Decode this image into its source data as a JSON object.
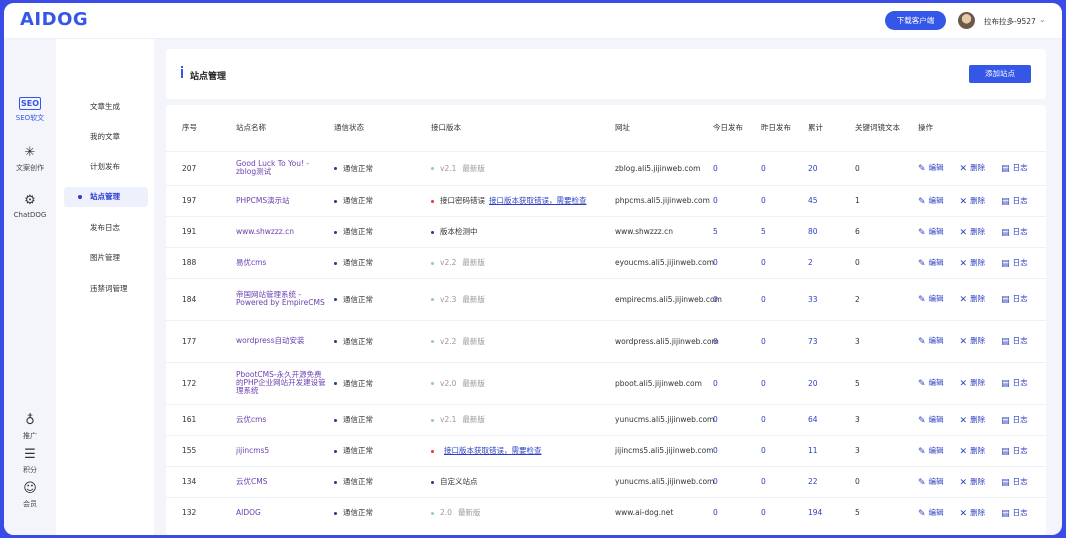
{
  "brand": {
    "logo": "AIDOG"
  },
  "topbar": {
    "download_label": "下载客户端",
    "username": "拉布拉多-9527"
  },
  "rail": [
    {
      "label": "SEO软文",
      "icon": "seo-icon",
      "active": true
    },
    {
      "label": "文案创作",
      "icon": "sparkle-icon",
      "active": false
    },
    {
      "label": "ChatDOG",
      "icon": "openai-icon",
      "active": false
    },
    {
      "label": "推广",
      "icon": "money-bag-icon",
      "active": false
    },
    {
      "label": "积分",
      "icon": "coins-icon",
      "active": false
    },
    {
      "label": "会员",
      "icon": "user-icon",
      "active": false
    }
  ],
  "sidebar": {
    "items": [
      {
        "label": "文章生成",
        "active": false
      },
      {
        "label": "我的文章",
        "active": false
      },
      {
        "label": "计划发布",
        "active": false
      },
      {
        "label": "站点管理",
        "active": true
      },
      {
        "label": "发布日志",
        "active": false
      },
      {
        "label": "图片管理",
        "active": false
      },
      {
        "label": "违禁词管理",
        "active": false
      }
    ]
  },
  "page": {
    "title": "站点管理",
    "add_label": "添加站点"
  },
  "table": {
    "columns": [
      "序号",
      "站点名称",
      "通信状态",
      "接口版本",
      "网址",
      "今日发布",
      "昨日发布",
      "累计",
      "关键词镜文本",
      "操作"
    ],
    "actions": {
      "edit": "编辑",
      "delete": "删除",
      "log": "日志"
    },
    "rows": [
      {
        "id": "207",
        "name": "Good Luck To You! - zblog测试",
        "status": "通信正常",
        "ver_type": "ok",
        "ver": "v2.1",
        "ver_note": "最新版",
        "url": "zblog.ali5.jijinweb.com",
        "today": "0",
        "yesterday": "0",
        "total": "20",
        "kw": "0"
      },
      {
        "id": "197",
        "name": "PHPCMS演示站",
        "status": "通信正常",
        "ver_type": "error",
        "ver": "接口密码错误",
        "ver_note": "接口版本获取错误，需要检查",
        "url": "phpcms.ali5.jijinweb.com",
        "today": "0",
        "yesterday": "0",
        "total": "45",
        "kw": "1"
      },
      {
        "id": "191",
        "name": "www.shwzzz.cn",
        "status": "通信正常",
        "ver_type": "plain",
        "ver": "版本检测中",
        "ver_note": "",
        "url": "www.shwzzz.cn",
        "today": "5",
        "yesterday": "5",
        "total": "80",
        "kw": "6"
      },
      {
        "id": "188",
        "name": "易优cms",
        "status": "通信正常",
        "ver_type": "ok",
        "ver": "v2.2",
        "ver_note": "最新版",
        "url": "eyoucms.ali5.jijinweb.com",
        "today": "0",
        "yesterday": "0",
        "total": "2",
        "kw": "0"
      },
      {
        "id": "184",
        "name": "帝国网站管理系统 - Powered by EmpireCMS",
        "status": "通信正常",
        "ver_type": "ok",
        "ver": "v2.3",
        "ver_note": "最新版",
        "url": "empirecms.ali5.jijinweb.com",
        "today": "0",
        "yesterday": "0",
        "total": "33",
        "kw": "2"
      },
      {
        "id": "177",
        "name": "wordpress自动安装",
        "status": "通信正常",
        "ver_type": "ok",
        "ver": "v2.2",
        "ver_note": "最新版",
        "url": "wordpress.ali5.jijinweb.com",
        "today": "0",
        "yesterday": "0",
        "total": "73",
        "kw": "3"
      },
      {
        "id": "172",
        "name": "PbootCMS-永久开源免费的PHP企业网站开发建设管理系统",
        "status": "通信正常",
        "ver_type": "ok",
        "ver": "v2.0",
        "ver_note": "最新版",
        "url": "pboot.ali5.jijinweb.com",
        "today": "0",
        "yesterday": "0",
        "total": "20",
        "kw": "5"
      },
      {
        "id": "161",
        "name": "云优cms",
        "status": "通信正常",
        "ver_type": "ok",
        "ver": "v2.1",
        "ver_note": "最新版",
        "url": "yunucms.ali5.jijinweb.com",
        "today": "0",
        "yesterday": "0",
        "total": "64",
        "kw": "3"
      },
      {
        "id": "155",
        "name": "jijincms5",
        "status": "通信正常",
        "ver_type": "error",
        "ver": "",
        "ver_note": "接口版本获取错误，需要检查",
        "url": "jijincms5.ali5.jijinweb.com",
        "today": "0",
        "yesterday": "0",
        "total": "11",
        "kw": "3"
      },
      {
        "id": "134",
        "name": "云优CMS",
        "status": "通信正常",
        "ver_type": "plain",
        "ver": "自定义站点",
        "ver_note": "",
        "url": "yunucms.ali5.jijinweb.com",
        "today": "0",
        "yesterday": "0",
        "total": "22",
        "kw": "0"
      },
      {
        "id": "132",
        "name": "AIDOG",
        "status": "通信正常",
        "ver_type": "ok",
        "ver": "2.0",
        "ver_note": "最新版",
        "url": "www.ai-dog.net",
        "today": "0",
        "yesterday": "0",
        "total": "194",
        "kw": "5"
      }
    ]
  }
}
